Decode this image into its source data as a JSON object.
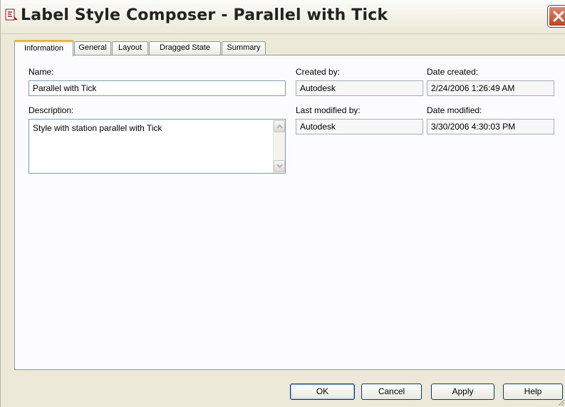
{
  "window": {
    "title": "Label Style Composer - Parallel with Tick"
  },
  "tabs": [
    {
      "label": "Information",
      "active": true
    },
    {
      "label": "General",
      "active": false
    },
    {
      "label": "Layout",
      "active": false
    },
    {
      "label": "Dragged State",
      "active": false
    },
    {
      "label": "Summary",
      "active": false
    }
  ],
  "information": {
    "name_label": "Name:",
    "name_value": "Parallel with Tick",
    "description_label": "Description:",
    "description_value": "Style with station parallel with Tick",
    "created_by_label": "Created by:",
    "created_by_value": "Autodesk",
    "date_created_label": "Date created:",
    "date_created_value": "2/24/2006 1:26:49 AM",
    "last_modified_by_label": "Last modified by:",
    "last_modified_by_value": "Autodesk",
    "date_modified_label": "Date modified:",
    "date_modified_value": "3/30/2006 4:30:03 PM"
  },
  "buttons": {
    "ok": "OK",
    "cancel": "Cancel",
    "apply": "Apply",
    "help": "Help"
  },
  "colors": {
    "dialog_background": "#ece9d8",
    "active_tab_accent": "#f0b431",
    "close_button": "#c4401f",
    "field_border": "#7f9db9"
  },
  "icons": {
    "app": "label-style-app-icon",
    "close": "close-icon",
    "scroll_up": "scroll-up-arrow-icon",
    "scroll_down": "scroll-down-arrow-icon"
  }
}
